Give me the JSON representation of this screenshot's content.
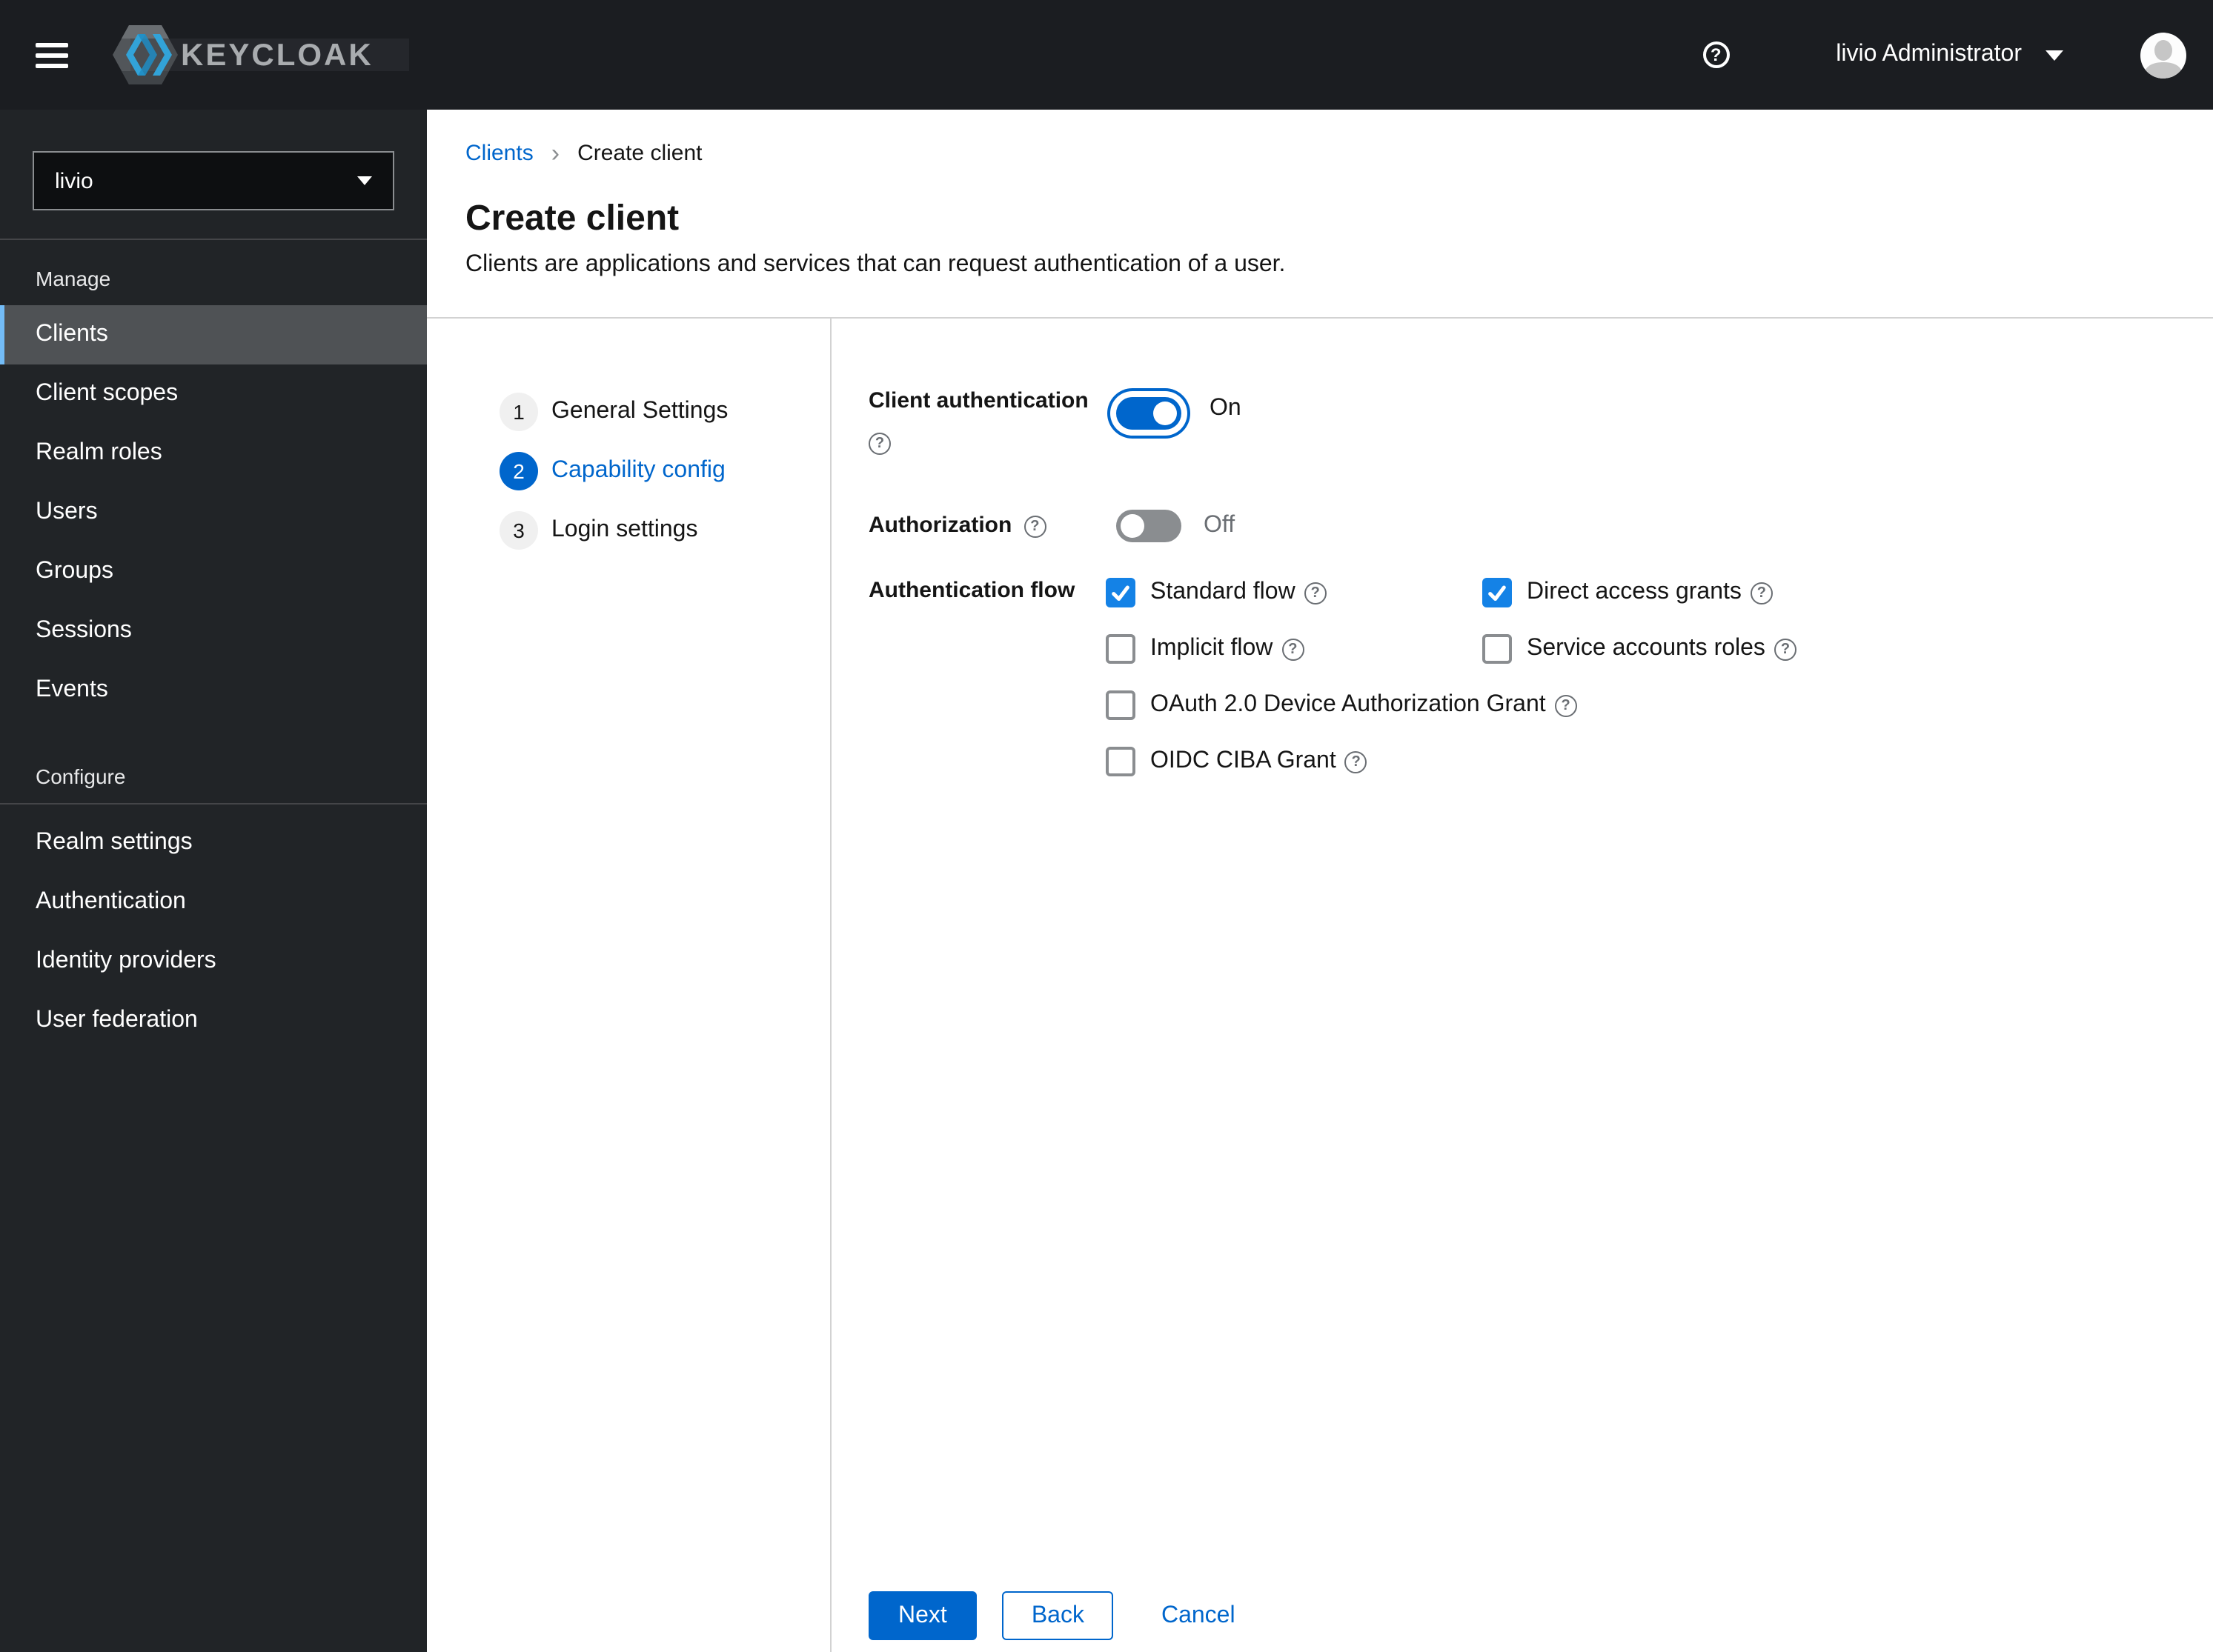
{
  "header": {
    "brand": "KEYCLOAK",
    "user": "livio Administrator"
  },
  "sidebar": {
    "realm": "livio",
    "sections": [
      {
        "title": "Manage",
        "items": [
          {
            "label": "Clients",
            "active": true
          },
          {
            "label": "Client scopes",
            "active": false
          },
          {
            "label": "Realm roles",
            "active": false
          },
          {
            "label": "Users",
            "active": false
          },
          {
            "label": "Groups",
            "active": false
          },
          {
            "label": "Sessions",
            "active": false
          },
          {
            "label": "Events",
            "active": false
          }
        ]
      },
      {
        "title": "Configure",
        "items": [
          {
            "label": "Realm settings",
            "active": false
          },
          {
            "label": "Authentication",
            "active": false
          },
          {
            "label": "Identity providers",
            "active": false
          },
          {
            "label": "User federation",
            "active": false
          }
        ]
      }
    ]
  },
  "breadcrumb": {
    "parent": "Clients",
    "current": "Create client"
  },
  "page": {
    "title": "Create client",
    "subtitle": "Clients are applications and services that can request authentication of a user."
  },
  "wizard": {
    "steps": [
      {
        "number": "1",
        "label": "General Settings",
        "state": "inactive"
      },
      {
        "number": "2",
        "label": "Capability config",
        "state": "current"
      },
      {
        "number": "3",
        "label": "Login settings",
        "state": "inactive"
      }
    ]
  },
  "form": {
    "client_authentication": {
      "label": "Client authentication",
      "value": "On"
    },
    "authorization": {
      "label": "Authorization",
      "value": "Off"
    },
    "authentication_flow": {
      "label": "Authentication flow",
      "options": [
        {
          "label": "Standard flow",
          "checked": true
        },
        {
          "label": "Direct access grants",
          "checked": true
        },
        {
          "label": "Implicit flow",
          "checked": false
        },
        {
          "label": "Service accounts roles",
          "checked": false
        },
        {
          "label": "OAuth 2.0 Device Authorization Grant",
          "checked": false
        },
        {
          "label": "OIDC CIBA Grant",
          "checked": false
        }
      ]
    }
  },
  "footer": {
    "next": "Next",
    "back": "Back",
    "cancel": "Cancel"
  },
  "colors": {
    "primary": "#0066cc",
    "checkbox_checked": "#1482e6",
    "nav_accent": "#73bcf7"
  }
}
